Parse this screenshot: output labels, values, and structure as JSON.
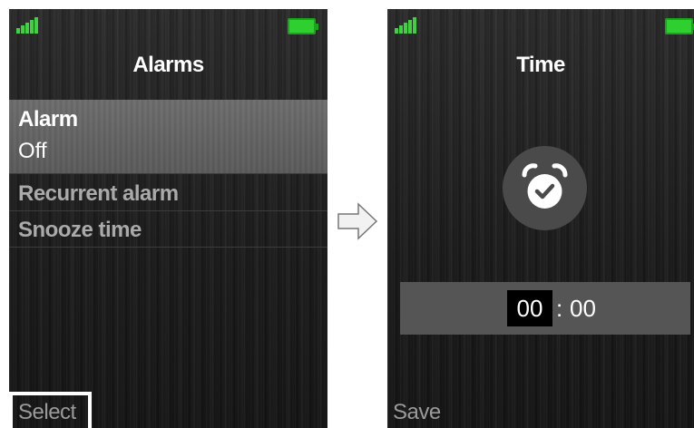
{
  "left_screen": {
    "title": "Alarms",
    "status": {
      "signal_icon": "signal-icon",
      "battery_icon": "battery-icon",
      "accent": "#3fd13f"
    },
    "menu": [
      {
        "label": "Alarm",
        "value": "Off",
        "selected": true
      },
      {
        "label": "Recurrent alarm"
      },
      {
        "label": "Snooze time"
      }
    ],
    "softkey": "Select"
  },
  "transition": {
    "icon": "right-arrow-icon"
  },
  "right_screen": {
    "title": "Time",
    "status": {
      "signal_icon": "signal-icon",
      "battery_icon": "battery-icon"
    },
    "icon": "alarm-clock-check-icon",
    "time": {
      "hours": "00",
      "separator": ":",
      "minutes": "00"
    },
    "softkey": "Save"
  }
}
